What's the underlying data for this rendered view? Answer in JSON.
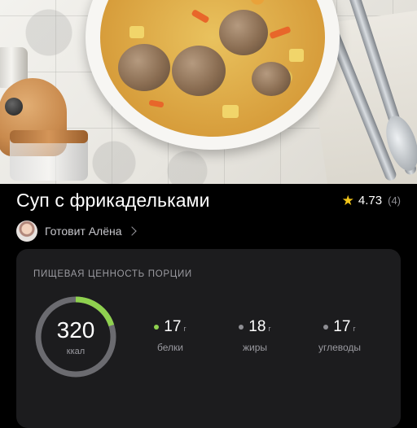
{
  "recipe": {
    "title": "Суп с фрикадельками",
    "rating": "4.73",
    "rating_count": "(4)",
    "author_label": "Готовит Алёна"
  },
  "nutrition": {
    "section_title": "ПИЩЕВАЯ ЦЕННОСТЬ ПОРЦИИ",
    "calories": "320",
    "calories_unit": "ккал",
    "calories_ring_progress": 0.2,
    "macros": [
      {
        "value": "17",
        "unit": "г",
        "label": "белки",
        "color": "#8fd14f"
      },
      {
        "value": "18",
        "unit": "г",
        "label": "жиры",
        "color": "#8e8e93"
      },
      {
        "value": "17",
        "unit": "г",
        "label": "углеводы",
        "color": "#8e8e93"
      }
    ]
  },
  "colors": {
    "background": "#000000",
    "card": "#1c1c1e",
    "accent_green": "#8fd14f",
    "ring_track": "#6b6b70",
    "star": "#f2c519"
  },
  "icons": {
    "rating": "star-icon",
    "author_link": "chevron-right-icon"
  }
}
